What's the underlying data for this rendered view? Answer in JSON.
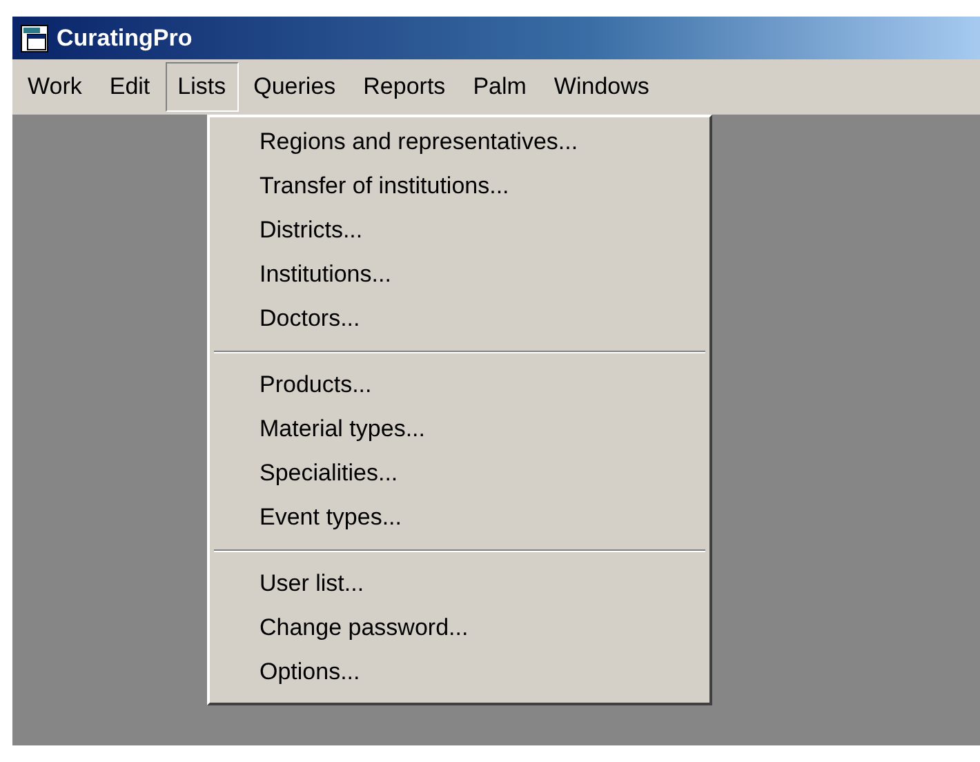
{
  "window": {
    "title": "CuratingPro"
  },
  "menu_bar": [
    {
      "label": "Work",
      "selected": false
    },
    {
      "label": "Edit",
      "selected": false
    },
    {
      "label": "Lists",
      "selected": true
    },
    {
      "label": "Queries",
      "selected": false
    },
    {
      "label": "Reports",
      "selected": false
    },
    {
      "label": "Palm",
      "selected": false
    },
    {
      "label": "Windows",
      "selected": false
    }
  ],
  "dropdown": {
    "items": [
      {
        "kind": "item",
        "label": "Regions and representatives..."
      },
      {
        "kind": "item",
        "label": "Transfer of institutions..."
      },
      {
        "kind": "item",
        "label": "Districts..."
      },
      {
        "kind": "item",
        "label": "Institutions..."
      },
      {
        "kind": "item",
        "label": "Doctors..."
      },
      {
        "kind": "separator"
      },
      {
        "kind": "item",
        "label": "Products..."
      },
      {
        "kind": "item",
        "label": "Material types..."
      },
      {
        "kind": "item",
        "label": "Specialities..."
      },
      {
        "kind": "item",
        "label": "Event types..."
      },
      {
        "kind": "separator"
      },
      {
        "kind": "item",
        "label": "User list..."
      },
      {
        "kind": "item",
        "label": "Change password..."
      },
      {
        "kind": "item",
        "label": "Options..."
      }
    ]
  }
}
